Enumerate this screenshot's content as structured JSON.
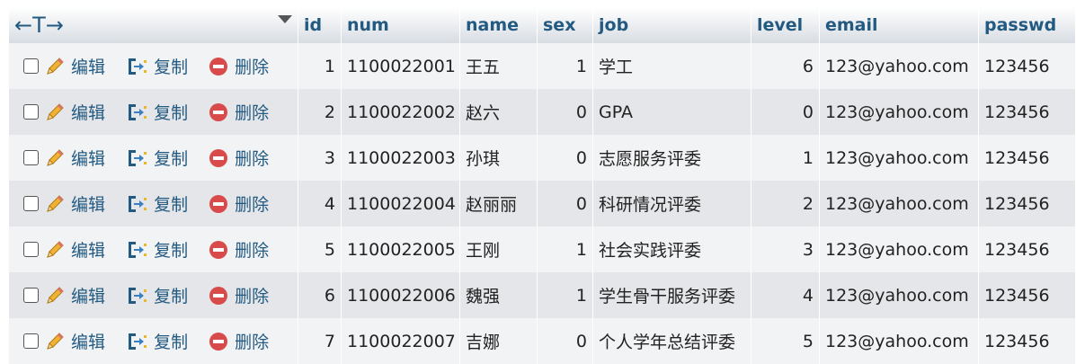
{
  "header": {
    "nav_arrows": "←T→",
    "columns": [
      "id",
      "num",
      "name",
      "sex",
      "job",
      "level",
      "email",
      "passwd"
    ]
  },
  "actions": {
    "edit": "编辑",
    "copy": "复制",
    "delete": "删除"
  },
  "rows": [
    {
      "id": "1",
      "num": "1100022001",
      "name": "王五",
      "sex": "1",
      "job": "学工",
      "level": "6",
      "email": "123@yahoo.com",
      "passwd": "123456"
    },
    {
      "id": "2",
      "num": "1100022002",
      "name": "赵六",
      "sex": "0",
      "job": "GPA",
      "level": "0",
      "email": "123@yahoo.com",
      "passwd": "123456"
    },
    {
      "id": "3",
      "num": "1100022003",
      "name": "孙琪",
      "sex": "0",
      "job": "志愿服务评委",
      "level": "1",
      "email": "123@yahoo.com",
      "passwd": "123456"
    },
    {
      "id": "4",
      "num": "1100022004",
      "name": "赵丽丽",
      "sex": "0",
      "job": "科研情况评委",
      "level": "2",
      "email": "123@yahoo.com",
      "passwd": "123456"
    },
    {
      "id": "5",
      "num": "1100022005",
      "name": "王刚",
      "sex": "1",
      "job": "社会实践评委",
      "level": "3",
      "email": "123@yahoo.com",
      "passwd": "123456"
    },
    {
      "id": "6",
      "num": "1100022006",
      "name": "魏强",
      "sex": "1",
      "job": "学生骨干服务评委",
      "level": "4",
      "email": "123@yahoo.com",
      "passwd": "123456"
    },
    {
      "id": "7",
      "num": "1100022007",
      "name": "吉娜",
      "sex": "0",
      "job": "个人学年总结评委",
      "level": "5",
      "email": "123@yahoo.com",
      "passwd": "123456"
    }
  ]
}
